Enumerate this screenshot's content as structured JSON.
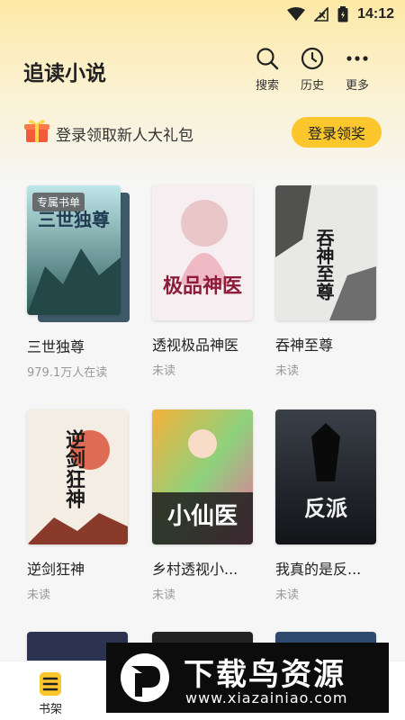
{
  "status_bar": {
    "time": "14:12"
  },
  "header": {
    "title": "追读小说",
    "search_label": "搜索",
    "history_label": "历史",
    "more_label": "更多"
  },
  "promo": {
    "text": "登录领取新人大礼包",
    "button": "登录领奖"
  },
  "books": [
    {
      "title": "三世独尊",
      "sub": "979.1万人在读",
      "badge": "专属书单",
      "cover_text": "三世独尊"
    },
    {
      "title": "透视极品神医",
      "sub": "未读",
      "cover_text": "极品神医"
    },
    {
      "title": "吞神至尊",
      "sub": "未读",
      "cover_text": "吞神至尊"
    },
    {
      "title": "逆剑狂神",
      "sub": "未读",
      "cover_text": "逆剑狂神"
    },
    {
      "title": "乡村透视小...",
      "sub": "未读",
      "cover_text": "小仙医"
    },
    {
      "title": "我真的是反...",
      "sub": "未读",
      "cover_text": "反派"
    }
  ],
  "bottom_nav": {
    "bookshelf_label": "书架"
  },
  "watermark": {
    "main": "下载鸟资源",
    "url": "www.xiazainiao.com"
  },
  "colors": {
    "accent": "#fbc72d",
    "header_bg": "#fde9a6"
  }
}
